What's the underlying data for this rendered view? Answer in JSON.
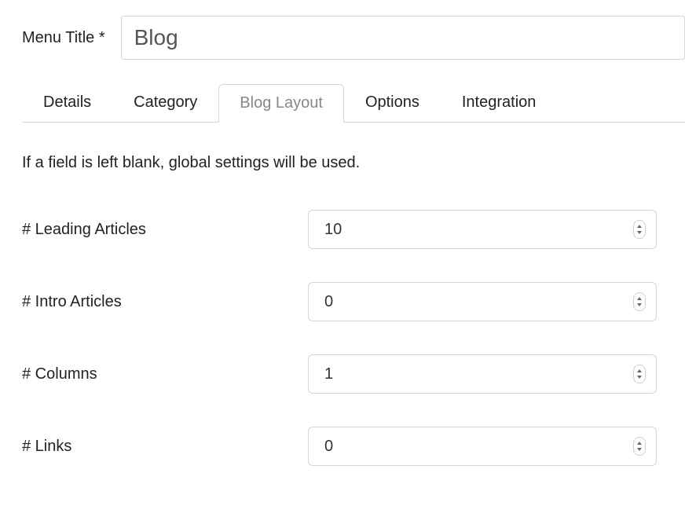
{
  "title": {
    "label": "Menu Title *",
    "value": "Blog"
  },
  "tabs": [
    {
      "label": "Details",
      "active": false
    },
    {
      "label": "Category",
      "active": false
    },
    {
      "label": "Blog Layout",
      "active": true
    },
    {
      "label": "Options",
      "active": false
    },
    {
      "label": "Integration",
      "active": false
    }
  ],
  "hint": "If a field is left blank, global settings will be used.",
  "fields": {
    "leading_articles": {
      "label": "# Leading Articles",
      "value": "10"
    },
    "intro_articles": {
      "label": "# Intro Articles",
      "value": "0"
    },
    "columns": {
      "label": "# Columns",
      "value": "1"
    },
    "links": {
      "label": "# Links",
      "value": "0"
    }
  }
}
